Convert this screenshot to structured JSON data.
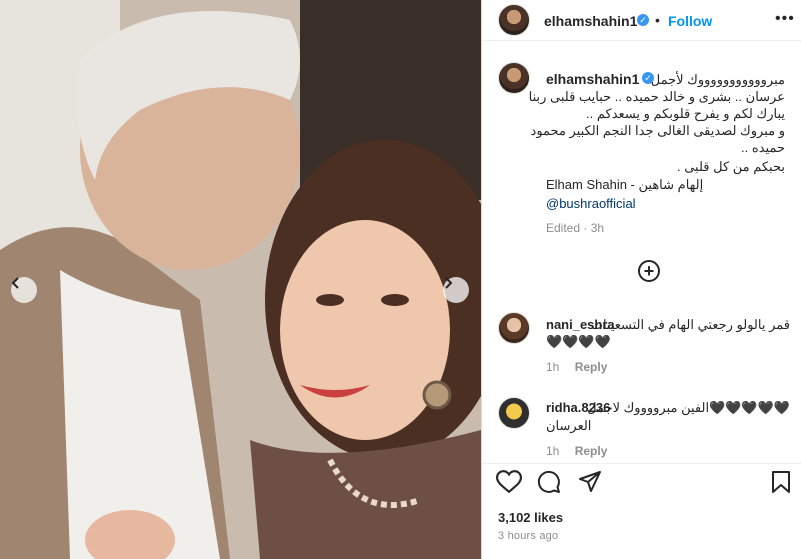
{
  "post": {
    "username": "elhamshahin1",
    "follow_label": "Follow",
    "dot": "•",
    "more_icon": "•••"
  },
  "caption": {
    "username": "elhamshahin1",
    "lines": [
      "مبروووووووووووك لأجمل",
      "عرسان .. بشرى و خالد حميده .. حبايب قلبى ربنا",
      "يبارك لكم و يفرح قلوبكم و يسعدكم ..",
      "و مبروك لصديقى الغالى جدا النجم الكبير محمود",
      "حميده ..",
      "بحبكم من كل قلبى .",
      "Elham Shahin - إلهام شاهين"
    ],
    "mention": "@bushraofficial",
    "edited": "Edited · 3h"
  },
  "comments": [
    {
      "username": "nani_eshra",
      "line1": "قمر يالولو رجعتي الهام في التسعينات",
      "line2": "🖤🖤🖤🖤",
      "time": "1h",
      "reply": "Reply"
    },
    {
      "username": "ridha.8236",
      "line1": "🖤🖤🖤🖤🖤الفين مبرووووك لاجمل",
      "line2": "العرسان",
      "time": "1h",
      "reply": "Reply"
    }
  ],
  "likes": "3,102 likes",
  "time_ago": "3 hours ago",
  "colors": {
    "accent": "#0095f6",
    "verified": "#3897f0",
    "muted": "#8e8e8e"
  },
  "icons": {
    "carousel_prev": "chevron-left-icon",
    "carousel_next": "chevron-right-icon",
    "like": "heart-icon",
    "comment": "comment-icon",
    "share": "paper-plane-icon",
    "save": "bookmark-icon",
    "load_more": "plus-circle-icon",
    "verified": "verified-badge-icon"
  }
}
